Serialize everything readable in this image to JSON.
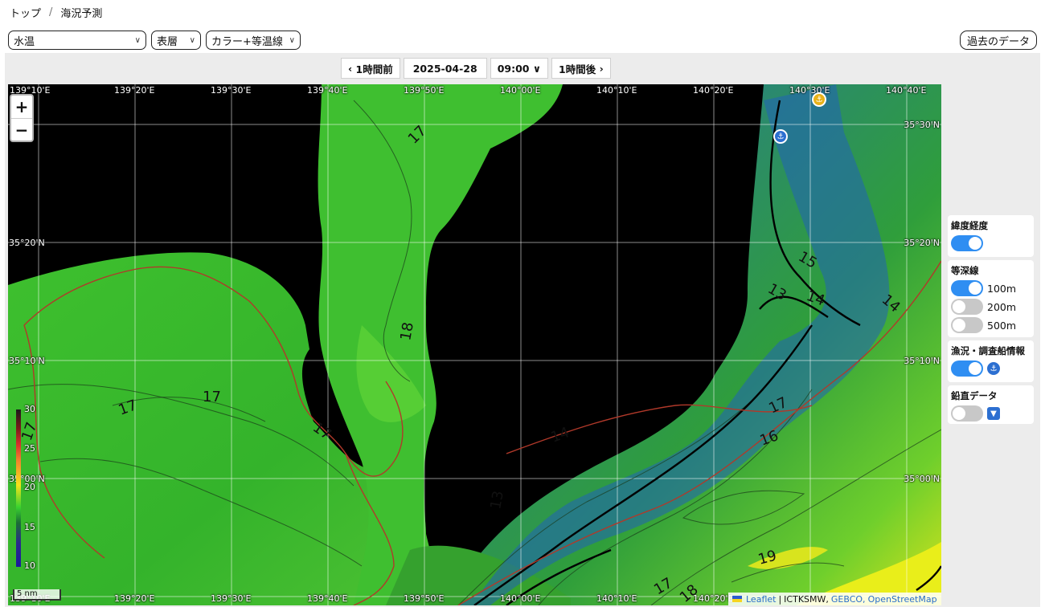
{
  "breadcrumb": {
    "home": "トップ",
    "separator": "/",
    "current": "海況予測"
  },
  "toolbar": {
    "variable": "水温",
    "layer": "表層",
    "display": "カラー+等温線",
    "past_data": "過去のデータ"
  },
  "timebar": {
    "prev": "1時間前",
    "date": "2025-04-28",
    "time": "09:00",
    "next": "1時間後"
  },
  "map": {
    "lon_labels_top": [
      "139°10'E",
      "139°20'E",
      "139°30'E",
      "139°40'E",
      "139°50'E",
      "140°00'E",
      "140°10'E",
      "140°20'E",
      "140°30'E",
      "140°40'E"
    ],
    "lon_labels_bottom": [
      "139°10'E",
      "139°20'E",
      "139°30'E",
      "139°40'E",
      "139°50'E",
      "140°00'E",
      "140°10'E",
      "140°20'E"
    ],
    "lat_labels": [
      "35°30'N",
      "35°20'N",
      "35°10'N",
      "35°00'N"
    ],
    "isotherm_labels": [
      "17",
      "18",
      "17",
      "17",
      "17",
      "17",
      "17",
      "16",
      "15",
      "14",
      "14",
      "13",
      "13",
      "14",
      "19",
      "17",
      "18"
    ],
    "colorbar_ticks": [
      "30",
      "25",
      "20",
      "15",
      "10"
    ],
    "zoom_in": "+",
    "zoom_out": "−",
    "scale": "5 nm",
    "attribution": {
      "leaflet": "Leaflet",
      "sep1": "|",
      "ictksmw": "ICTKSMW,",
      "gebco": "GEBCO,",
      "osm": "OpenStreetMap"
    }
  },
  "side_panel": {
    "latlon": {
      "title": "緯度経度",
      "on": true
    },
    "depth": {
      "title": "等深線",
      "items": [
        {
          "label": "100m",
          "on": true
        },
        {
          "label": "200m",
          "on": false
        },
        {
          "label": "500m",
          "on": false
        }
      ]
    },
    "fishery": {
      "title": "漁況・調査船情報",
      "on": true,
      "icon": "buoy-icon"
    },
    "vertical": {
      "title": "鉛直データ",
      "on": false,
      "icon": "vertical-data-icon"
    }
  }
}
